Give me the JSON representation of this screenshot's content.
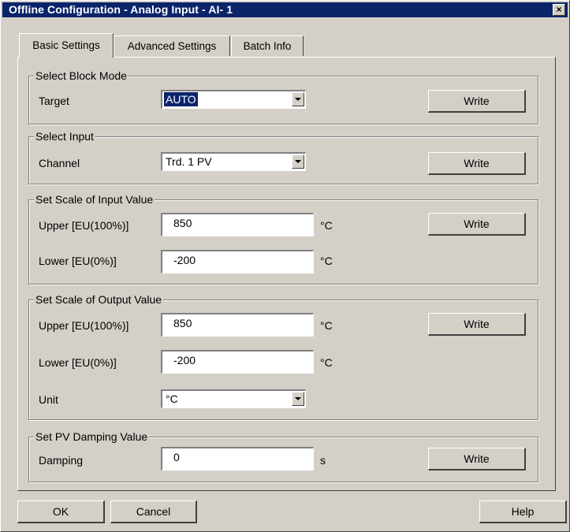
{
  "window": {
    "title": "Offline Configuration - Analog Input - AI- 1",
    "close_glyph": "×"
  },
  "tabs": [
    {
      "label": "Basic Settings",
      "active": true
    },
    {
      "label": "Advanced Settings",
      "active": false
    },
    {
      "label": "Batch Info",
      "active": false
    }
  ],
  "block_mode": {
    "group_title": "Select Block Mode",
    "target_label": "Target",
    "target_value": "AUTO",
    "write_label": "Write"
  },
  "input": {
    "group_title": "Select Input",
    "channel_label": "Channel",
    "channel_value": "Trd. 1 PV",
    "write_label": "Write"
  },
  "input_scale": {
    "group_title": "Set Scale of Input Value",
    "upper_label": "Upper [EU(100%)]",
    "upper_value": "850",
    "upper_unit": "°C",
    "lower_label": "Lower [EU(0%)]",
    "lower_value": "-200",
    "lower_unit": "°C",
    "write_label": "Write"
  },
  "output_scale": {
    "group_title": "Set Scale of Output Value",
    "upper_label": "Upper [EU(100%)]",
    "upper_value": "850",
    "upper_unit": "°C",
    "lower_label": "Lower [EU(0%)]",
    "lower_value": "-200",
    "lower_unit": "°C",
    "unit_label": "Unit",
    "unit_value": "°C",
    "write_label": "Write"
  },
  "damping": {
    "group_title": "Set PV Damping Value",
    "label": "Damping",
    "value": "0",
    "unit": "s",
    "write_label": "Write"
  },
  "footer": {
    "ok_label": "OK",
    "cancel_label": "Cancel",
    "help_label": "Help"
  },
  "colors": {
    "title_bar": "#0a246a",
    "face": "#d4d0c8",
    "selection": "#0a246a"
  }
}
